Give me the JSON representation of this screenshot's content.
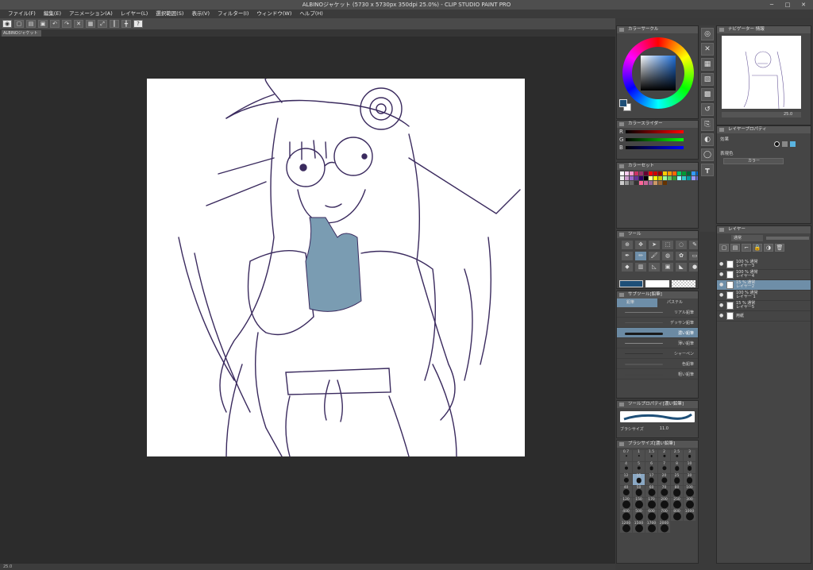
{
  "window": {
    "title": "ALBINOジャケット (5730 x 5730px 350dpi 25.0%) - CLIP STUDIO PAINT PRO",
    "min": "─",
    "max": "□",
    "close": "✕"
  },
  "menu": [
    "ファイル(F)",
    "編集(E)",
    "アニメーション(A)",
    "レイヤー(L)",
    "選択範囲(S)",
    "表示(V)",
    "フィルター(I)",
    "ウィンドウ(W)",
    "ヘルプ(H)"
  ],
  "document": {
    "tab_label": "ALBINOジャケット"
  },
  "toolbar": {
    "icons": [
      "eye-icon",
      "new-icon",
      "open-icon",
      "save-icon",
      "undo-icon",
      "redo-icon",
      "clear-icon",
      "fill-icon",
      "transform-icon",
      "help-icon"
    ]
  },
  "color_wheel": {
    "header": "カラーサークル",
    "main_color": "#1e4f78",
    "sub_color": "#ffffff"
  },
  "color_slider": {
    "header": "カラースライダー",
    "labels": [
      "R",
      "G",
      "B"
    ],
    "values": [
      "",
      "",
      ""
    ]
  },
  "color_set": {
    "header": "カラーセット"
  },
  "tools": {
    "header": "ツール"
  },
  "subtool": {
    "header": "サブツール[鉛筆]",
    "tabs": [
      "鉛筆",
      "パステル"
    ],
    "items": [
      "リアル鉛筆",
      "デッサン鉛筆",
      "濃い鉛筆",
      "薄い鉛筆",
      "シャーペン",
      "色鉛筆",
      "粗い鉛筆"
    ],
    "active_index": 2
  },
  "tool_property": {
    "header": "ツールプロパティ[濃い鉛筆]",
    "brush_size_label": "ブラシサイズ",
    "brush_size_value": "11.0"
  },
  "brush_size": {
    "header": "ブラシサイズ[濃い鉛筆]",
    "sizes": [
      "0.7",
      "1",
      "1.5",
      "2",
      "2.5",
      "3",
      "4",
      "5",
      "6",
      "7",
      "8",
      "10",
      "12",
      "15",
      "17",
      "20",
      "25",
      "30",
      "40",
      "50",
      "60",
      "70",
      "80",
      "100",
      "120",
      "150",
      "170",
      "200",
      "250",
      "300",
      "400",
      "500",
      "600",
      "700",
      "800",
      "1000",
      "1200",
      "1500",
      "1700",
      "2000"
    ],
    "active_index": 13
  },
  "navigator": {
    "header": "ナビゲーター",
    "tab2": "情報",
    "zoom": "25.0"
  },
  "layer_property": {
    "header": "レイヤープロパティ",
    "effect_label": "効果",
    "color_label": "表現色",
    "color_value": "カラー"
  },
  "layers": {
    "header": "レイヤー",
    "blend_mode": "通常",
    "items": [
      {
        "name": "100 % 通常",
        "sub": "レイヤー3"
      },
      {
        "name": "100 % 通常",
        "sub": "レイヤー4"
      },
      {
        "name": "15 % 通常",
        "sub": "レイヤー2"
      },
      {
        "name": "100 % 通常",
        "sub": "レイヤー 1"
      },
      {
        "name": "15 % 通常",
        "sub": "レイヤー5"
      },
      {
        "name": "",
        "sub": "用紙"
      }
    ],
    "active_index": 2
  },
  "status": {
    "zoom": "25.0"
  }
}
